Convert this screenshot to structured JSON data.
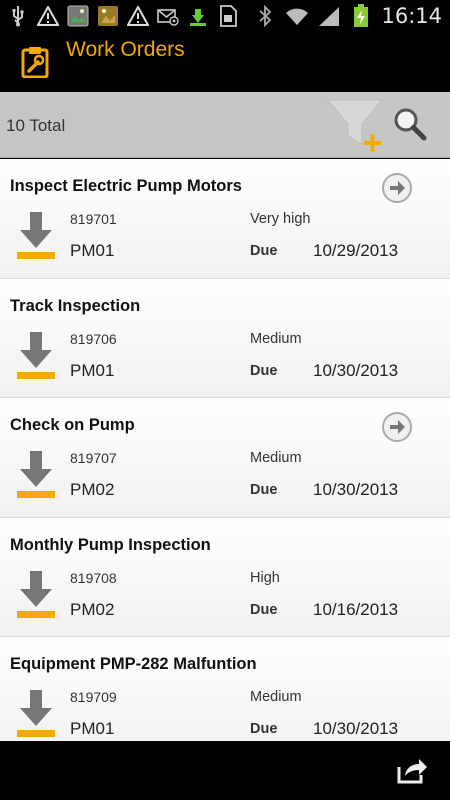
{
  "status_bar": {
    "time": "16:14",
    "left_icons": [
      "usb-icon",
      "warning-icon",
      "image-icon",
      "photo-warning-icon",
      "warning-icon",
      "email-icon",
      "download-icon",
      "sim-card-icon"
    ],
    "right_icons": [
      "bluetooth-icon",
      "wifi-icon",
      "signal-icon",
      "battery-charging-icon"
    ]
  },
  "header": {
    "title": "Work Orders",
    "icon": "clipboard-wrench-icon",
    "accent_color": "#f2a900"
  },
  "summary": {
    "total_text": "10 Total",
    "filter_icon": "funnel-add-icon",
    "search_icon": "search-icon"
  },
  "work_orders": [
    {
      "title": "Inspect Electric Pump Motors",
      "number": "819701",
      "priority": "Very high",
      "type": "PM01",
      "due_label": "Due",
      "due_date": "10/29/2013",
      "has_arrow": true
    },
    {
      "title": "Track Inspection",
      "number": "819706",
      "priority": "Medium",
      "type": "PM01",
      "due_label": "Due",
      "due_date": "10/30/2013",
      "has_arrow": false
    },
    {
      "title": "Check on Pump",
      "number": "819707",
      "priority": "Medium",
      "type": "PM02",
      "due_label": "Due",
      "due_date": "10/30/2013",
      "has_arrow": true
    },
    {
      "title": "Monthly Pump Inspection",
      "number": "819708",
      "priority": "High",
      "type": "PM02",
      "due_label": "Due",
      "due_date": "10/16/2013",
      "has_arrow": false
    },
    {
      "title": "Equipment PMP-282 Malfuntion",
      "number": "819709",
      "priority": "Medium",
      "type": "PM01",
      "due_label": "Due",
      "due_date": "10/30/2013",
      "has_arrow": false
    }
  ],
  "bottom_bar": {
    "share_icon": "share-icon"
  }
}
